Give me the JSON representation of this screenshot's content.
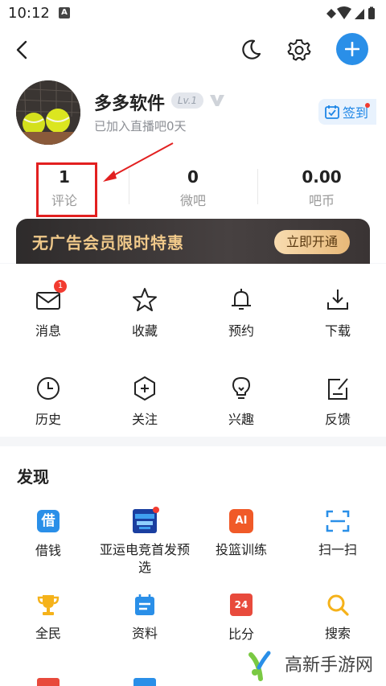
{
  "status": {
    "time": "10:12",
    "notif_badge": "A"
  },
  "header": {
    "back_icon": "back-arrow-icon",
    "night_icon": "moon-icon",
    "settings_icon": "gear-icon",
    "add_icon": "plus-icon"
  },
  "profile": {
    "name": "多多软件",
    "level": "Lv.1",
    "subtitle": "已加入直播吧0天",
    "signin_label": "签到"
  },
  "stats": [
    {
      "value": "1",
      "label": "评论"
    },
    {
      "value": "0",
      "label": "微吧"
    },
    {
      "value": "0.00",
      "label": "吧币"
    }
  ],
  "vip": {
    "title": "无广告会员限时特惠",
    "button": "立即开通"
  },
  "grid": [
    {
      "label": "消息",
      "icon": "mail-icon",
      "badge": "1"
    },
    {
      "label": "收藏",
      "icon": "star-icon"
    },
    {
      "label": "预约",
      "icon": "bell-icon"
    },
    {
      "label": "下载",
      "icon": "download-icon"
    },
    {
      "label": "历史",
      "icon": "clock-icon"
    },
    {
      "label": "关注",
      "icon": "hexagon-plus-icon"
    },
    {
      "label": "兴趣",
      "icon": "bulb-icon"
    },
    {
      "label": "反馈",
      "icon": "edit-icon"
    }
  ],
  "discover": {
    "title": "发现",
    "items": [
      {
        "label": "借钱",
        "icon": "borrow-icon",
        "icon_text": "借"
      },
      {
        "label": "亚运电竞首发预选",
        "icon": "esports-icon"
      },
      {
        "label": "投篮训练",
        "icon": "ai-icon",
        "icon_text": "AI"
      },
      {
        "label": "扫一扫",
        "icon": "scan-icon"
      },
      {
        "label": "全民",
        "icon": "trophy-icon"
      },
      {
        "label": "资料",
        "icon": "calendar-icon"
      },
      {
        "label": "比分",
        "icon": "score-icon",
        "icon_text": "24"
      },
      {
        "label": "搜索",
        "icon": "search-icon"
      }
    ]
  },
  "watermark": {
    "text": "高新手游网"
  },
  "colors": {
    "accent": "#2a8fe8",
    "highlight": "#e22020",
    "vip_gold": "#f0c98a"
  }
}
